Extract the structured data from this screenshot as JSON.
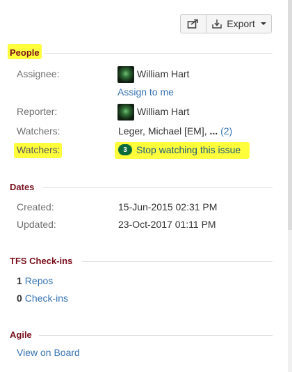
{
  "toolbar": {
    "export_label": "Export"
  },
  "people": {
    "header": "People",
    "assignee_label": "Assignee:",
    "assignee_name": "William Hart",
    "assign_to_me": "Assign to me",
    "reporter_label": "Reporter:",
    "reporter_name": "William Hart",
    "watchers_label": "Watchers:",
    "watchers_list": "Leger, Michael [EM],",
    "watchers_more": "...",
    "watchers_count_link": "(2)",
    "watchers_action_label": "Watchers:",
    "watch_badge": "3",
    "watch_action": "Stop watching this issue"
  },
  "dates": {
    "header": "Dates",
    "created_label": "Created:",
    "created_value": "15-Jun-2015 02:31 PM",
    "updated_label": "Updated:",
    "updated_value": "23-Oct-2017 01:11 PM"
  },
  "tfs": {
    "header": "TFS Check-ins",
    "repos_count": "1",
    "repos_label": "Repos",
    "checkins_count": "0",
    "checkins_label": "Check-ins"
  },
  "agile": {
    "header": "Agile",
    "view_on_board": "View on Board"
  },
  "colors": {
    "section_header": "#7a0f1b",
    "link": "#3572b0",
    "highlight": "#ffff3c",
    "badge": "#0b6b3a"
  },
  "icons": {
    "share": "share-icon",
    "export": "download-icon",
    "caret": "chevron-down-icon"
  }
}
